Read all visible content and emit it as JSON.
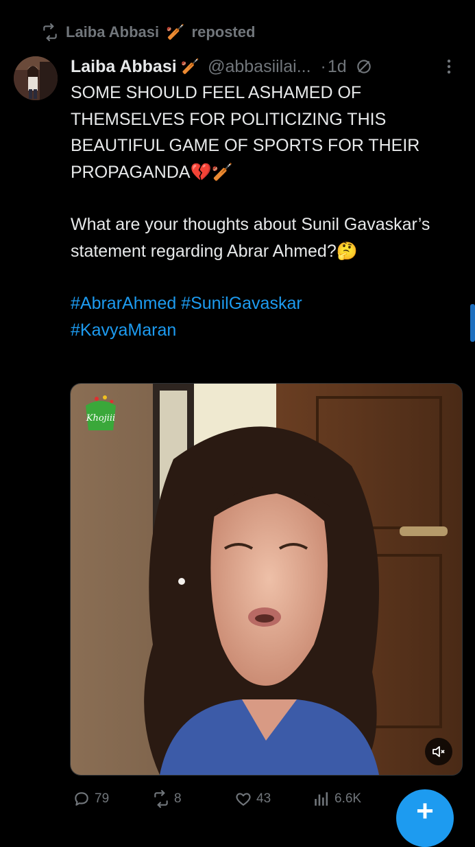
{
  "repost": {
    "name": "Laiba Abbasi",
    "emoji": "🏏",
    "label": "reposted"
  },
  "post": {
    "author_name": "Laiba Abbasi",
    "author_emoji": "🏏",
    "handle": "@abbasiilai...",
    "dot": "·",
    "time": "1d",
    "text_line1": "SOME SHOULD FEEL ASHAMED OF THEMSELVES FOR POLITICIZING THIS BEAUTIFUL GAME OF SPORTS FOR THEIR PROPAGANDA💔🏏",
    "text_line2": "What are your thoughts about Sunil Gavaskar’s statement regarding Abrar Ahmed?🤔",
    "hashtags": [
      "#AbrarAhmed",
      "#SunilGavaskar",
      "#KavyaMaran"
    ],
    "media_logo_text": "Khojiii"
  },
  "actions": {
    "replies": "79",
    "reposts": "8",
    "likes": "43",
    "views": "6.6K"
  },
  "fab": {
    "label": "+"
  },
  "colors": {
    "background": "#000000",
    "text": "#e7e9ea",
    "muted": "#71767b",
    "accent": "#1d9bf0"
  },
  "icons": [
    "repost-icon",
    "grok-icon",
    "more-icon",
    "mute-icon",
    "reply-icon",
    "like-icon",
    "views-icon",
    "compose-icon"
  ]
}
